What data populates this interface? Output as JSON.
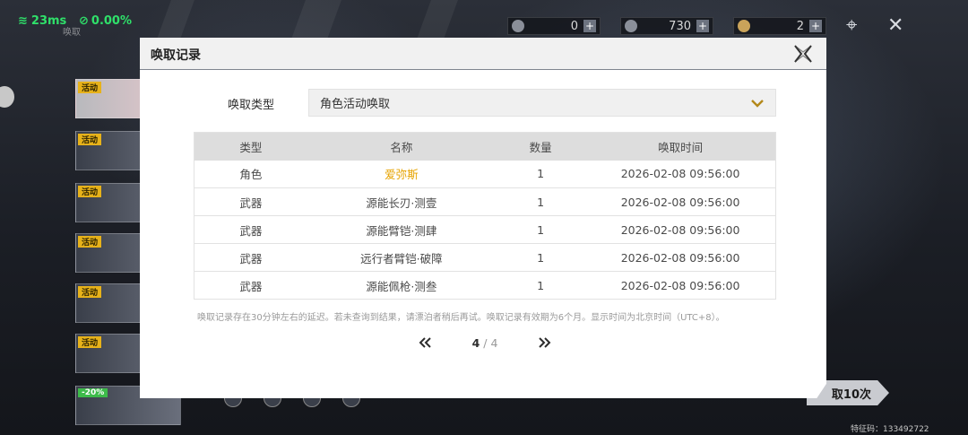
{
  "status": {
    "ping": "23ms",
    "loss": "0.00%",
    "sub_label": "唤取"
  },
  "currency": [
    {
      "icon": "orb-icon",
      "value": "0"
    },
    {
      "icon": "star-icon",
      "value": "730"
    },
    {
      "icon": "coin-icon",
      "value": "2"
    }
  ],
  "banners": [
    {
      "tag": "活动"
    },
    {
      "tag": "活动"
    },
    {
      "tag": "活动"
    },
    {
      "tag": "活动"
    },
    {
      "tag": "活动"
    },
    {
      "tag": "活动"
    },
    {
      "tag": "-20%"
    }
  ],
  "summon_ten_label": "取10次",
  "verification": "特征码：133492722",
  "dialog": {
    "title": "唤取记录",
    "type_label": "唤取类型",
    "type_value": "角色活动唤取",
    "columns": [
      "类型",
      "名称",
      "数量",
      "唤取时间"
    ],
    "rows": [
      {
        "type": "角色",
        "name": "爱弥斯",
        "qty": "1",
        "time": "2026-02-08 09:56:00"
      },
      {
        "type": "武器",
        "name": "源能长刃·测壹",
        "qty": "1",
        "time": "2026-02-08 09:56:00"
      },
      {
        "type": "武器",
        "name": "源能臂铠·测肆",
        "qty": "1",
        "time": "2026-02-08 09:56:00"
      },
      {
        "type": "武器",
        "name": "远行者臂铠·破障",
        "qty": "1",
        "time": "2026-02-08 09:56:00"
      },
      {
        "type": "武器",
        "name": "源能佩枪·测叁",
        "qty": "1",
        "time": "2026-02-08 09:56:00"
      }
    ],
    "note": "唤取记录存在30分钟左右的延迟。若未查询到结果，请漂泊者稍后再试。唤取记录有效期为6个月。显示时间为北京时间（UTC+8）。",
    "page_current": "4",
    "page_total": "/ 4"
  },
  "colors": {
    "highlight_name": "#e6a300",
    "accent_gold": "#d4a016"
  }
}
